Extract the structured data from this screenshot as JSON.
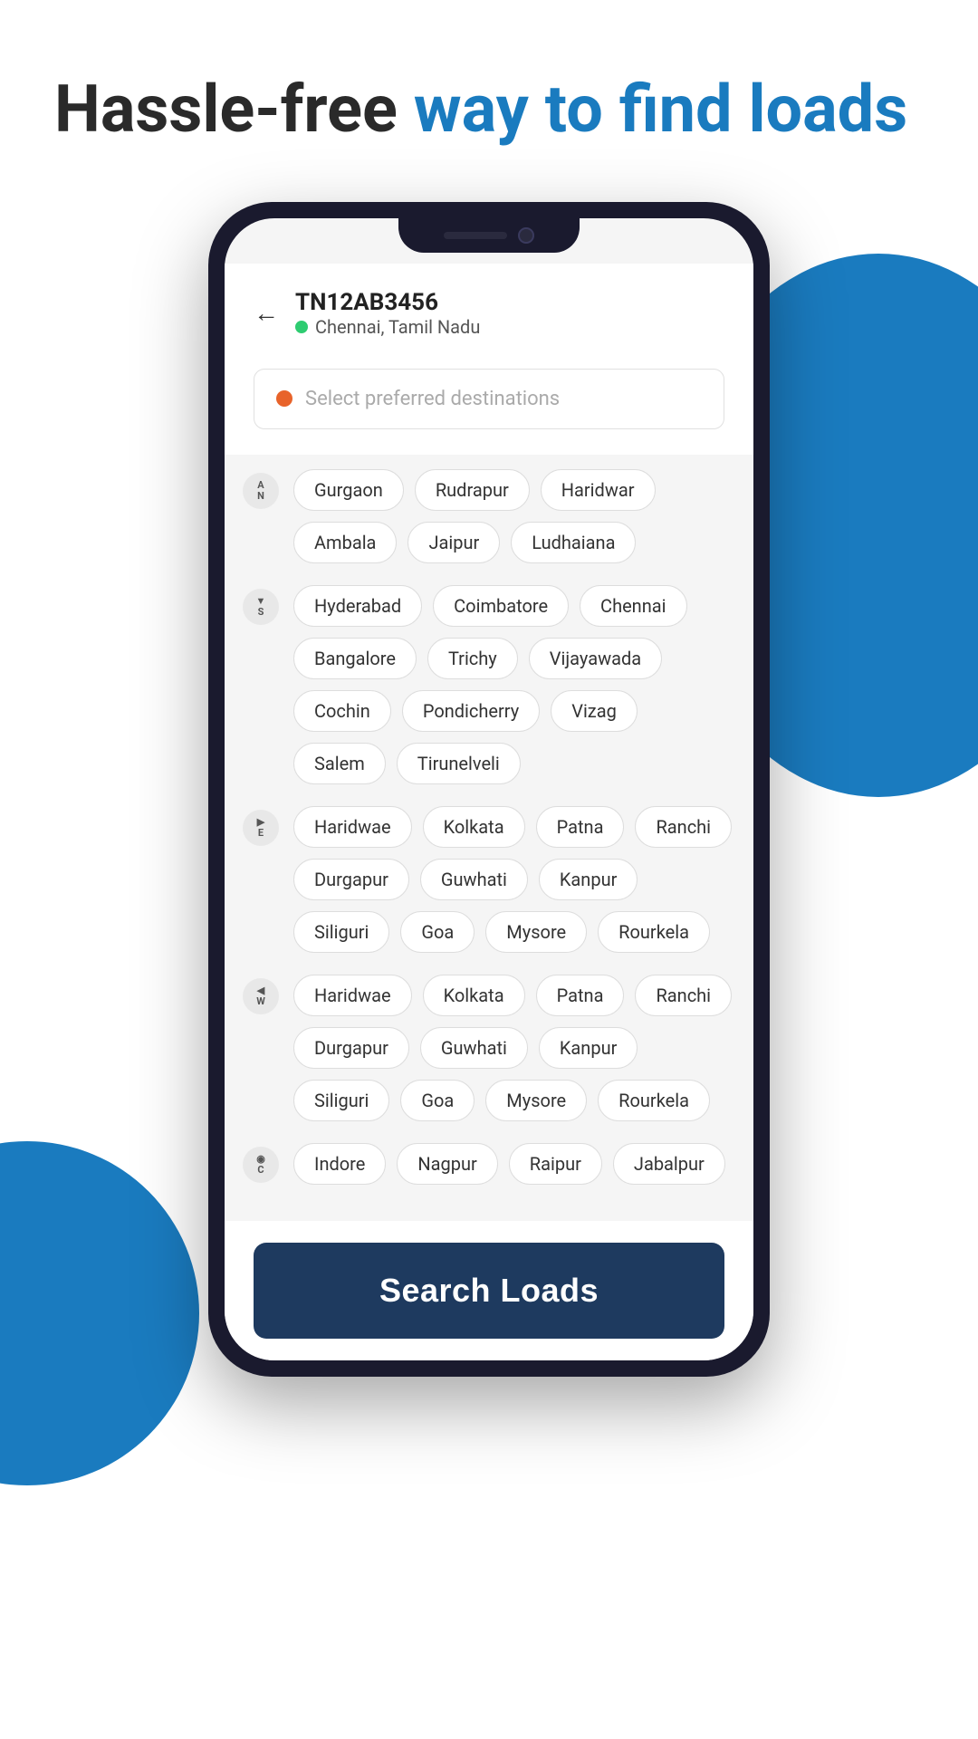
{
  "headline": {
    "part1": "Hassle-free ",
    "part2": "way to find loads"
  },
  "phone": {
    "vehicle_number": "TN12AB3456",
    "location": "Chennai, Tamil Nadu",
    "back_icon": "←",
    "search_placeholder": "Select preferred destinations"
  },
  "directions": [
    {
      "id": "north",
      "label": "N",
      "symbol": "↑\nN",
      "tags": [
        "Gurgaon",
        "Rudrapur",
        "Haridwar",
        "Ambala",
        "Jaipur",
        "Ludhaiana"
      ]
    },
    {
      "id": "south",
      "label": "S",
      "symbol": "↓\nS",
      "tags": [
        "Hyderabad",
        "Coimbatore",
        "Chennai",
        "Bangalore",
        "Trichy",
        "Vijayawada",
        "Cochin",
        "Pondicherry",
        "Vizag",
        "Salem",
        "Tirunelveli"
      ]
    },
    {
      "id": "east",
      "label": "E",
      "symbol": "→\nE",
      "tags": [
        "Haridwae",
        "Kolkata",
        "Patna",
        "Ranchi",
        "Durgapur",
        "Guwhati",
        "Kanpur",
        "Siliguri",
        "Goa",
        "Mysore",
        "Rourkela"
      ]
    },
    {
      "id": "west",
      "label": "W",
      "symbol": "←\nW",
      "tags": [
        "Haridwae",
        "Kolkata",
        "Patna",
        "Ranchi",
        "Durgapur",
        "Guwhati",
        "Kanpur",
        "Siliguri",
        "Goa",
        "Mysore",
        "Rourkela"
      ]
    },
    {
      "id": "central",
      "label": "C",
      "symbol": "◎\nC",
      "tags": [
        "Indore",
        "Nagpur",
        "Raipur",
        "Jabalpur"
      ]
    }
  ],
  "search_button_label": "Search Loads",
  "colors": {
    "blue": "#1a7bbf",
    "dark_navy": "#1e3a5f",
    "headline_dark": "#2a2a2a"
  }
}
